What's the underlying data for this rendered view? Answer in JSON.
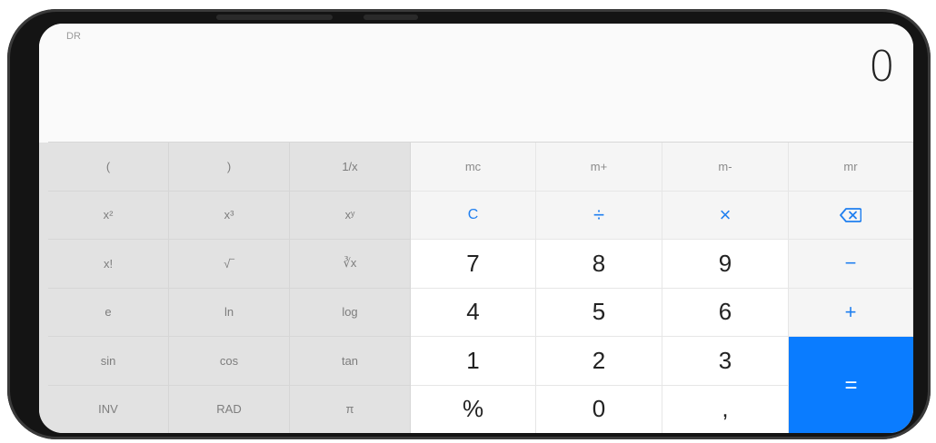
{
  "display": {
    "mode_label": "DR",
    "value": "0"
  },
  "keys": {
    "open_paren": "(",
    "close_paren": ")",
    "reciprocal": "1/x",
    "mc": "mc",
    "m_plus": "m+",
    "m_minus": "m-",
    "mr": "mr",
    "square": "x²",
    "cube": "x³",
    "power": "xʸ",
    "clear": "C",
    "divide": "÷",
    "multiply": "×",
    "factorial": "x!",
    "sqrt": "√‾",
    "cbrt": "∛x",
    "seven": "7",
    "eight": "8",
    "nine": "9",
    "minus": "−",
    "euler": "e",
    "ln": "ln",
    "log": "log",
    "four": "4",
    "five": "5",
    "six": "6",
    "plus": "+",
    "sin": "sin",
    "cos": "cos",
    "tan": "tan",
    "one": "1",
    "two": "2",
    "three": "3",
    "equals": "=",
    "inv": "INV",
    "rad": "RAD",
    "pi": "π",
    "percent": "%",
    "zero": "0",
    "decimal": ","
  },
  "icons": {
    "backspace": "backspace-icon"
  },
  "colors": {
    "accent": "#0a7cff",
    "operator_text": "#1f7ff0",
    "scientific_bg": "#e2e2e2"
  }
}
